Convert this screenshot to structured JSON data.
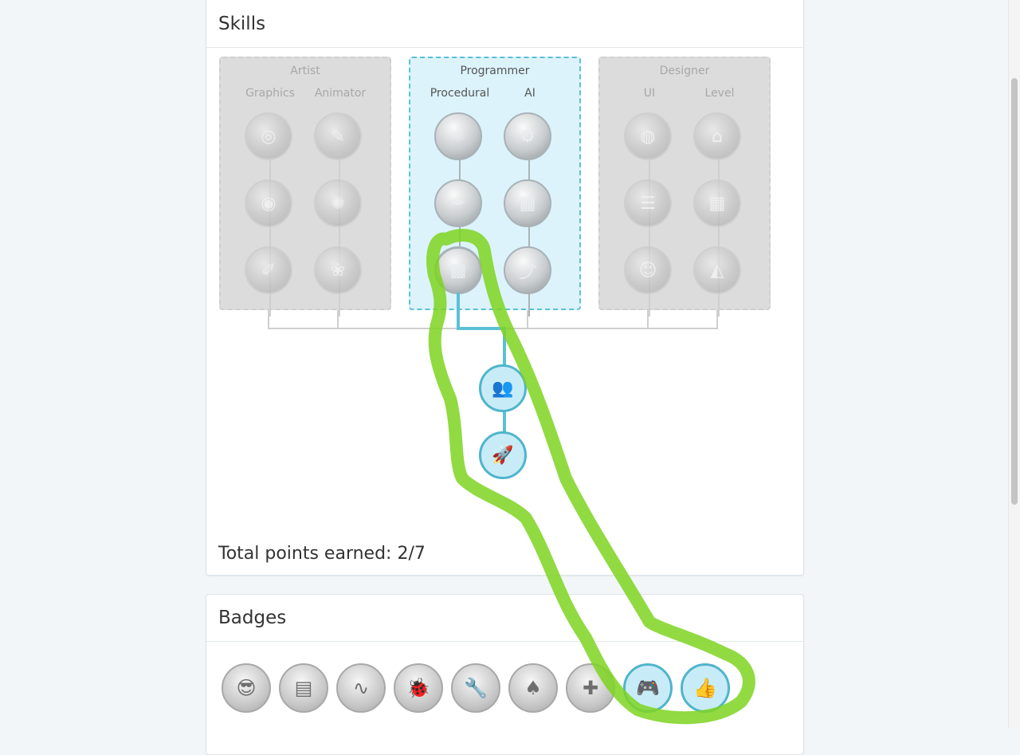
{
  "skills_panel": {
    "title": "Skills",
    "trees": [
      {
        "name": "Artist",
        "columns": [
          "Graphics",
          "Animator"
        ],
        "active": false
      },
      {
        "name": "Programmer",
        "columns": [
          "Procedural",
          "AI"
        ],
        "active": true
      },
      {
        "name": "Designer",
        "columns": [
          "UI",
          "Level"
        ],
        "active": false
      }
    ],
    "total_points_label": "Total points earned: 2/7",
    "total_points_earned": 2,
    "total_points_max": 7
  },
  "badges_panel": {
    "title": "Badges",
    "badges": [
      {
        "icon": "glasses-fox-icon",
        "earned": false
      },
      {
        "icon": "browser-window-icon",
        "earned": false
      },
      {
        "icon": "graph-card-icon",
        "earned": false
      },
      {
        "icon": "bug-magnifier-icon",
        "earned": false
      },
      {
        "icon": "wrench-icon",
        "earned": false
      },
      {
        "icon": "playing-card-icon",
        "earned": false
      },
      {
        "icon": "bandage-icon",
        "earned": false
      },
      {
        "icon": "gamepad-icon",
        "earned": true
      },
      {
        "icon": "thumbs-up-icon",
        "earned": true
      }
    ]
  },
  "colors": {
    "accent": "#5bc0d6",
    "highlight": "#7ed321",
    "inactive": "#cfcfcf"
  }
}
